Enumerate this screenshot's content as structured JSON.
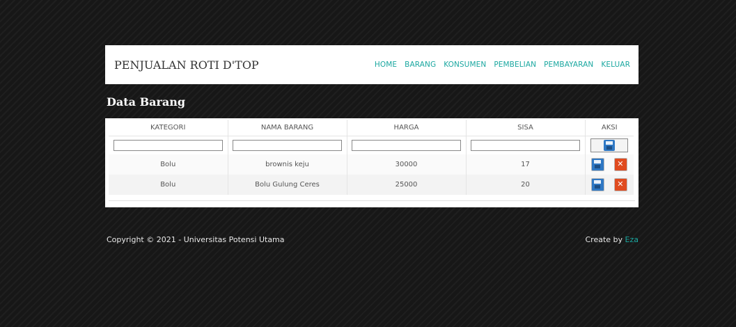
{
  "header": {
    "brand": "PENJUALAN ROTI D'TOP",
    "nav": [
      "HOME",
      "BARANG",
      "KONSUMEN",
      "PEMBELIAN",
      "PEMBAYARAN",
      "KELUAR"
    ]
  },
  "page_title": "Data Barang",
  "table": {
    "columns": [
      "KATEGORI",
      "NAMA BARANG",
      "HARGA",
      "SISA",
      "AKSI"
    ],
    "rows": [
      {
        "kategori": "Bolu",
        "nama": "brownis keju",
        "harga": "30000",
        "sisa": "17"
      },
      {
        "kategori": "Bolu",
        "nama": "Bolu Gulung Ceres",
        "harga": "25000",
        "sisa": "20"
      }
    ]
  },
  "icons": {
    "save": "save-icon",
    "delete": "delete-icon"
  },
  "colors": {
    "nav": "#1aa7a0",
    "background": "#171717"
  },
  "footer": {
    "copyright": "Copyright © 2021 - Universitas Potensi Utama",
    "create_by": "Create by",
    "author": "Eza"
  }
}
